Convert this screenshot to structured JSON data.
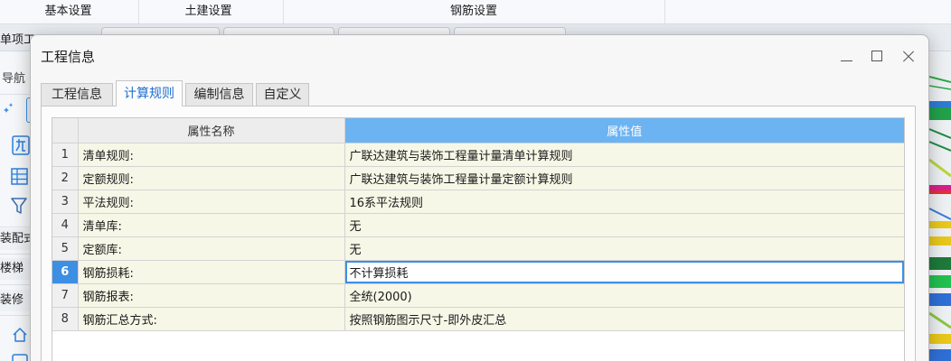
{
  "app": {
    "ribbon_sections": [
      "基本设置",
      "土建设置",
      "钢筋设置"
    ],
    "document_tab_label": "单项工",
    "nav": {
      "title": "导航",
      "icons": [
        "sparkle-icon",
        "component-icon",
        "grid-icon",
        "filter-icon",
        "home-icon"
      ],
      "categories": [
        "装配式",
        "楼梯",
        "装修"
      ]
    }
  },
  "dialog": {
    "title": "工程信息",
    "window_controls": [
      "minimize-icon",
      "maximize-icon",
      "close-icon"
    ],
    "tabs": [
      {
        "label": "工程信息",
        "selected": false
      },
      {
        "label": "计算规则",
        "selected": true
      },
      {
        "label": "编制信息",
        "selected": false
      },
      {
        "label": "自定义",
        "selected": false
      }
    ],
    "table": {
      "columns": {
        "name": "属性名称",
        "value": "属性值"
      },
      "rows": [
        {
          "index": "1",
          "name": "清单规则:",
          "value": "广联达建筑与装饰工程量计量清单计算规则",
          "selected": false
        },
        {
          "index": "2",
          "name": "定额规则:",
          "value": "广联达建筑与装饰工程量计量定额计算规则",
          "selected": false
        },
        {
          "index": "3",
          "name": "平法规则:",
          "value": "16系平法规则",
          "selected": false
        },
        {
          "index": "4",
          "name": "清单库:",
          "value": "无",
          "selected": false
        },
        {
          "index": "5",
          "name": "定额库:",
          "value": "无",
          "selected": false
        },
        {
          "index": "6",
          "name": "钢筋损耗:",
          "value": "不计算损耗",
          "selected": true
        },
        {
          "index": "7",
          "name": "钢筋报表:",
          "value": "全统(2000)",
          "selected": false
        },
        {
          "index": "8",
          "name": "钢筋汇总方式:",
          "value": "按照钢筋图示尺寸-即外皮汇总",
          "selected": false
        }
      ]
    }
  },
  "colors": {
    "accent": "#3d8fe3",
    "header_highlight": "#6cb3f2",
    "row_background": "#f6f7e6",
    "selected_tab_text": "#1f6fd0"
  }
}
